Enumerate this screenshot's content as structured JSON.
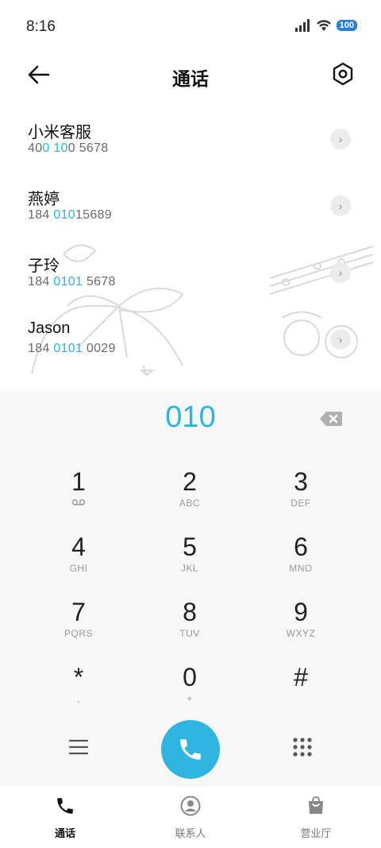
{
  "status_bar": {
    "time": "8:16",
    "battery": "100"
  },
  "header": {
    "title": "通话",
    "back_icon": "back-arrow-icon",
    "settings_icon": "settings-icon"
  },
  "contacts": [
    {
      "name": "小米客服",
      "number_parts": [
        "40",
        "0 10",
        "0 5678"
      ]
    },
    {
      "name": "燕婷",
      "number_parts": [
        "184 ",
        "010",
        "15689"
      ]
    },
    {
      "name": "子玲",
      "number_parts": [
        "184 ",
        "0101",
        " 5678"
      ]
    },
    {
      "name": "Jason",
      "number_parts": [
        "184 ",
        "0101",
        " 0029"
      ]
    }
  ],
  "dialer": {
    "input": "010",
    "keys": [
      {
        "num": "1",
        "letters": "voicemail"
      },
      {
        "num": "2",
        "letters": "ABC"
      },
      {
        "num": "3",
        "letters": "DEF"
      },
      {
        "num": "4",
        "letters": "GHI"
      },
      {
        "num": "5",
        "letters": "JKL"
      },
      {
        "num": "6",
        "letters": "MNO"
      },
      {
        "num": "7",
        "letters": "PQRS"
      },
      {
        "num": "8",
        "letters": "TUV"
      },
      {
        "num": "9",
        "letters": "WXYZ"
      },
      {
        "num": "*",
        "letters": ","
      },
      {
        "num": "0",
        "letters": "+"
      },
      {
        "num": "#",
        "letters": ""
      }
    ]
  },
  "bottom_nav": {
    "calls": "通话",
    "contacts": "联系人",
    "store": "营业厅"
  },
  "colors": {
    "accent": "#2bb5df",
    "call_button": "#2fb5e0",
    "battery": "#2a7de1"
  }
}
